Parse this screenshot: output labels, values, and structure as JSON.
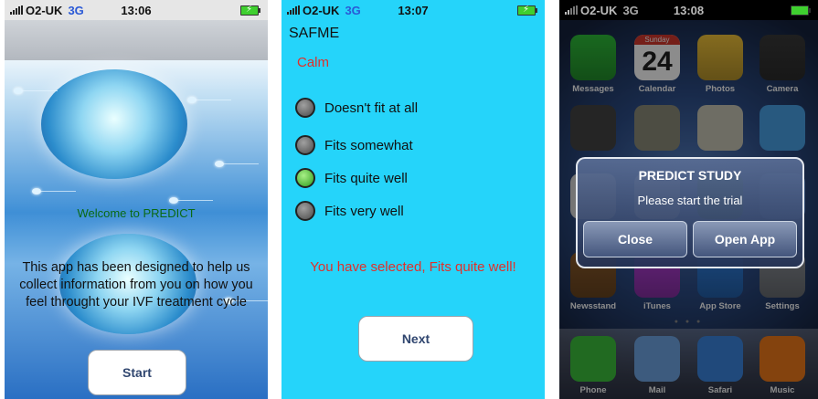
{
  "screen1": {
    "status": {
      "carrier": "O2-UK",
      "network": "3G",
      "time": "13:06"
    },
    "welcome": "Welcome to PREDICT",
    "intro": "This app has been designed to help us collect information from you on how you feel throught your IVF treatment cycle",
    "start_label": "Start"
  },
  "screen2": {
    "status": {
      "carrier": "O2-UK",
      "network": "3G",
      "time": "13:07"
    },
    "title": "SAFME",
    "item_label": "Calm",
    "options": [
      {
        "label": "Doesn't fit at all",
        "selected": false
      },
      {
        "label": "Fits somewhat",
        "selected": false
      },
      {
        "label": "Fits quite well",
        "selected": true
      },
      {
        "label": "Fits very well",
        "selected": false
      }
    ],
    "selection_message": "You have selected, Fits quite well!",
    "next_label": "Next",
    "colors": {
      "background": "#25d4fa",
      "accent_text": "#e0302a",
      "selected_radio": "#3dbb2a"
    }
  },
  "screen3": {
    "status": {
      "carrier": "O2-UK",
      "network": "3G",
      "time": "13:08"
    },
    "apps": [
      {
        "label": "Messages",
        "icon": "messages-icon",
        "color": "#2fbf3a"
      },
      {
        "label": "Calendar",
        "icon": "calendar-icon",
        "color": "#ffffff",
        "day": "Sunday",
        "date": "24"
      },
      {
        "label": "Photos",
        "icon": "photos-icon",
        "color": "#f2c43a"
      },
      {
        "label": "Camera",
        "icon": "camera-icon",
        "color": "#3a3a3a"
      },
      {
        "label": "Newsstand",
        "icon": "newsstand-icon",
        "color": "#8a5a2a"
      },
      {
        "label": "iTunes",
        "icon": "itunes-icon",
        "color": "#b23fd8"
      },
      {
        "label": "App Store",
        "icon": "app-store-icon",
        "color": "#2f7fe0"
      },
      {
        "label": "Settings",
        "icon": "settings-icon",
        "color": "#8a8f96"
      }
    ],
    "dock": [
      {
        "label": "Phone",
        "icon": "phone-icon",
        "color": "#3cc23c"
      },
      {
        "label": "Mail",
        "icon": "mail-icon",
        "color": "#6fa7e6"
      },
      {
        "label": "Safari",
        "icon": "safari-icon",
        "color": "#3b86e0"
      },
      {
        "label": "Music",
        "icon": "music-icon",
        "color": "#f07a1a"
      }
    ],
    "alert": {
      "title": "PREDICT STUDY",
      "message": "Please start the trial",
      "close_label": "Close",
      "open_label": "Open App"
    }
  }
}
